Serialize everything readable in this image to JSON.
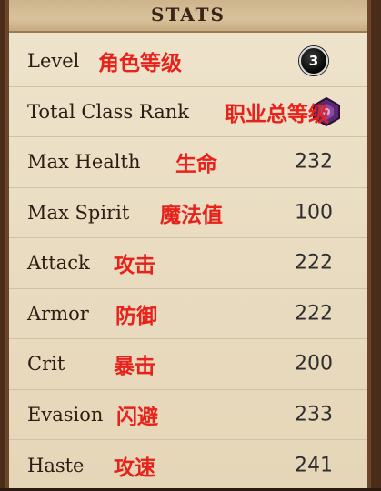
{
  "panel": {
    "title": "STATS"
  },
  "stats": [
    {
      "label": "Level",
      "cn": "角色等级",
      "value": "3"
    },
    {
      "label": "Total Class Rank",
      "cn": "职业总等级",
      "value": ""
    },
    {
      "label": "Max Health",
      "cn": "生命",
      "value": "232"
    },
    {
      "label": "Max Spirit",
      "cn": "魔法值",
      "value": "100"
    },
    {
      "label": "Attack",
      "cn": "攻击",
      "value": "222"
    },
    {
      "label": "Armor",
      "cn": "防御",
      "value": "222"
    },
    {
      "label": "Crit",
      "cn": "暴击",
      "value": "200"
    },
    {
      "label": "Evasion",
      "cn": "闪避",
      "value": "233"
    },
    {
      "label": "Haste",
      "cn": "攻速",
      "value": "241"
    }
  ],
  "icons": {
    "level": "level-badge-icon",
    "rank": "class-rank-icon"
  },
  "colors": {
    "annotation": "#e8211b",
    "parchment": "#efe4cd",
    "border": "#6b4528"
  }
}
